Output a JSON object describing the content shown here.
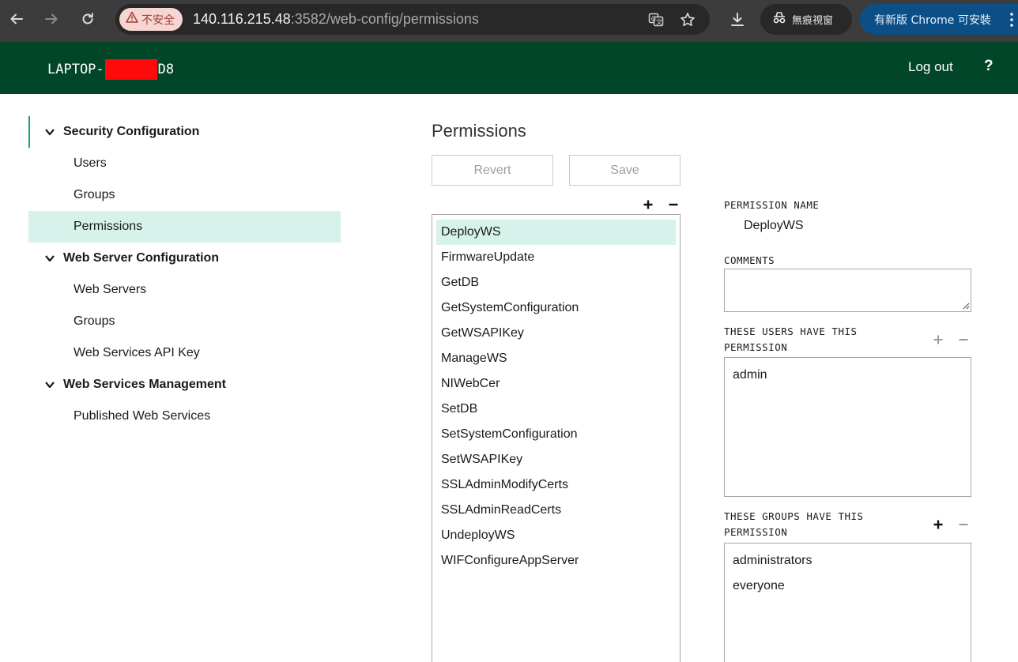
{
  "browser": {
    "security_label": "不安全",
    "url_host": "140.116.215.48",
    "url_path": ":3582/web-config/permissions",
    "incognito_label": "無痕視窗",
    "update_label": "有新版 Chrome 可安裝",
    "icons": {
      "back": "back-arrow-icon",
      "forward": "forward-arrow-icon",
      "reload": "reload-icon",
      "warning": "warning-icon",
      "translate": "translate-icon",
      "bookmark": "star-icon",
      "download": "download-icon",
      "incognito": "incognito-icon"
    }
  },
  "header": {
    "host_prefix": "LAPTOP-",
    "host_suffix": "D8",
    "logout_label": "Log out",
    "help_label": "?",
    "background": "#02462a",
    "redaction_color": "#ff0a0a"
  },
  "sidebar": {
    "sections": [
      {
        "label": "Security Configuration",
        "items": [
          "Users",
          "Groups",
          "Permissions"
        ]
      },
      {
        "label": "Web Server Configuration",
        "items": [
          "Web Servers",
          "Groups",
          "Web Services API Key"
        ]
      },
      {
        "label": "Web Services Management",
        "items": [
          "Published Web Services"
        ]
      }
    ],
    "selected_item": "Permissions",
    "accent": "#1fa36a",
    "selected_bg": "#d7f2ea"
  },
  "main": {
    "title": "Permissions",
    "revert_label": "Revert",
    "save_label": "Save",
    "permissions": [
      "DeployWS",
      "FirmwareUpdate",
      "GetDB",
      "GetSystemConfiguration",
      "GetWSAPIKey",
      "ManageWS",
      "NIWebCer",
      "SetDB",
      "SetSystemConfiguration",
      "SetWSAPIKey",
      "SSLAdminModifyCerts",
      "SSLAdminReadCerts",
      "UndeployWS",
      "WIFConfigureAppServer"
    ],
    "selected_permission": "DeployWS"
  },
  "details": {
    "permission_name_label": "PERMISSION NAME",
    "permission_name": "DeployWS",
    "comments_label": "COMMENTS",
    "comments_value": "",
    "users_label_line1": "THESE USERS HAVE THIS",
    "users_label_line2": "PERMISSION",
    "users": [
      "admin"
    ],
    "groups_label_line1": "THESE GROUPS HAVE THIS",
    "groups_label_line2": "PERMISSION",
    "groups": [
      "administrators",
      "everyone"
    ]
  }
}
